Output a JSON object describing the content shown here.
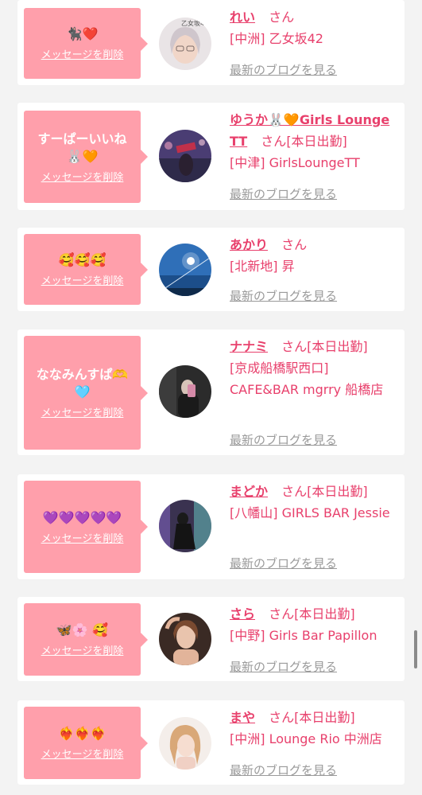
{
  "delete_label": "メッセージを削除",
  "blog_label": "最新のブログを見る",
  "honorific": "さん",
  "entries": [
    {
      "message": "🐈‍⬛❤️",
      "name": "れい",
      "status": "",
      "shop": "[中洲] 乙女坂42",
      "avatar_caption": "乙女坂42"
    },
    {
      "message": "すーぱーいいね🐰🧡",
      "name": "ゆうか🐰🧡Girls Lounge TT",
      "status": "[本日出勤]",
      "shop": "[中津] GirlsLoungeTT",
      "avatar_caption": ""
    },
    {
      "message": "🥰🥰🥰",
      "name": "あかり",
      "status": "",
      "shop": "[北新地] 昇",
      "avatar_caption": ""
    },
    {
      "message": "ななみんすぱ🫶🩵",
      "name": "ナナミ",
      "status": "[本日出勤]",
      "shop": "[京成船橋駅西口] CAFE&BAR mgrry 船橋店",
      "avatar_caption": ""
    },
    {
      "message": "💜💜💜💜💜",
      "name": "まどか",
      "status": "[本日出勤]",
      "shop": "[八幡山] GIRLS BAR Jessie",
      "avatar_caption": ""
    },
    {
      "message": "🦋🌸 🥰",
      "name": "さら",
      "status": "[本日出勤]",
      "shop": "[中野] Girls Bar Papillon",
      "avatar_caption": ""
    },
    {
      "message": "❤️‍🔥❤️‍🔥❤️‍🔥",
      "name": "まや",
      "status": "[本日出勤]",
      "shop": "[中洲] Lounge Rio 中洲店",
      "avatar_caption": ""
    }
  ],
  "colors": {
    "bubble": "#ff9fab",
    "accent": "#e8406c",
    "muted": "#9a9a9a",
    "background": "#f3f3f3"
  }
}
